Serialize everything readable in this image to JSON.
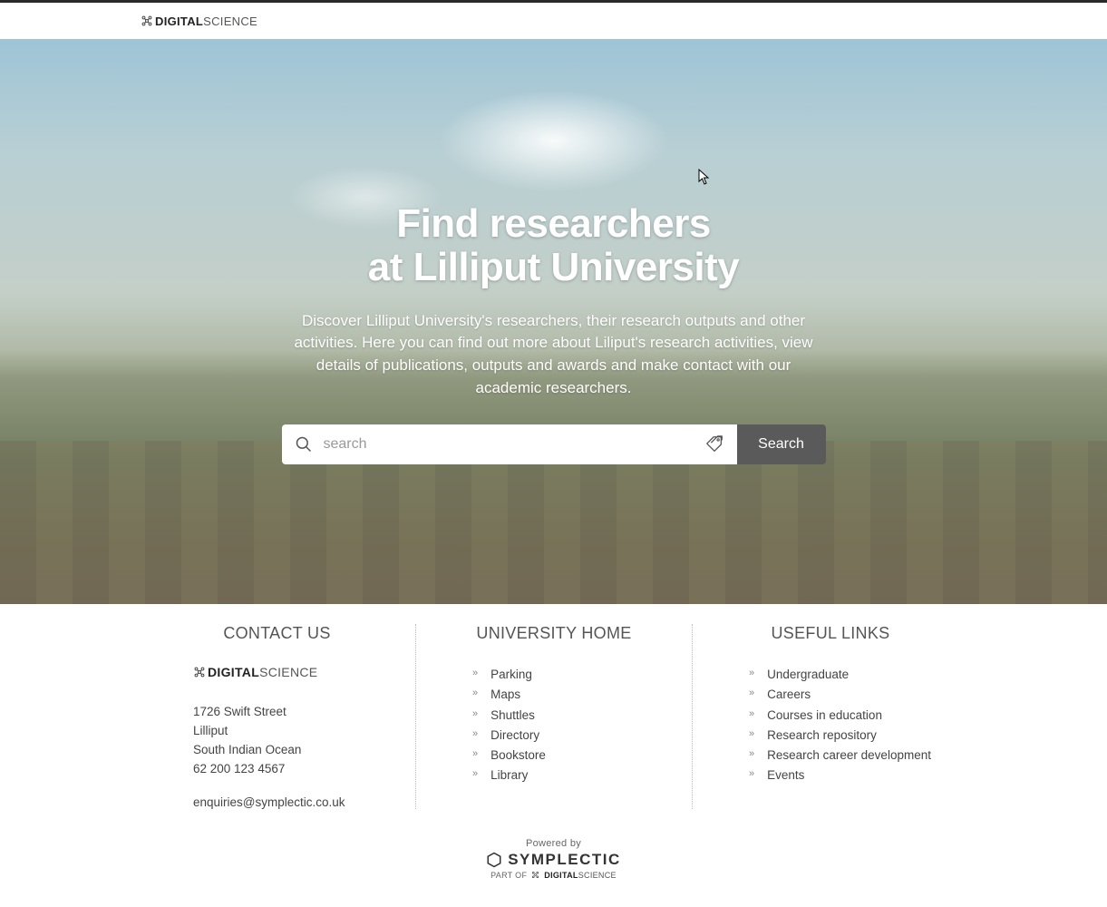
{
  "header": {
    "brand_bold": "DIGITAL",
    "brand_light": "SCIENCE"
  },
  "hero": {
    "title_line1": "Find researchers",
    "title_line2": "at Lilliput University",
    "description": "Discover Lilliput University's researchers, their research outputs and other activities. Here you can find out more about Liliput's research activities, view details of publications, outputs and awards and make contact with our academic researchers.",
    "search_placeholder": "search",
    "search_button": "Search"
  },
  "footer": {
    "contact": {
      "heading": "CONTACT US",
      "brand_bold": "DIGITAL",
      "brand_light": "SCIENCE",
      "address_line1": "1726 Swift Street",
      "address_line2": "Lilliput",
      "address_line3": "South Indian Ocean",
      "phone": "62 200 123 4567",
      "email": "enquiries@symplectic.co.uk"
    },
    "university": {
      "heading": "UNIVERSITY HOME",
      "links": [
        "Parking",
        "Maps",
        "Shuttles",
        "Directory",
        "Bookstore",
        "Library"
      ]
    },
    "useful": {
      "heading": "USEFUL LINKS",
      "links": [
        "Undergraduate",
        "Careers",
        "Courses in education",
        "Research repository",
        "Research career development",
        "Events"
      ]
    },
    "powered": {
      "label": "Powered by",
      "brand": "SYMPLECTIC",
      "partof": "PART OF",
      "ds_bold": "DIGITAL",
      "ds_light": "SCIENCE"
    }
  }
}
